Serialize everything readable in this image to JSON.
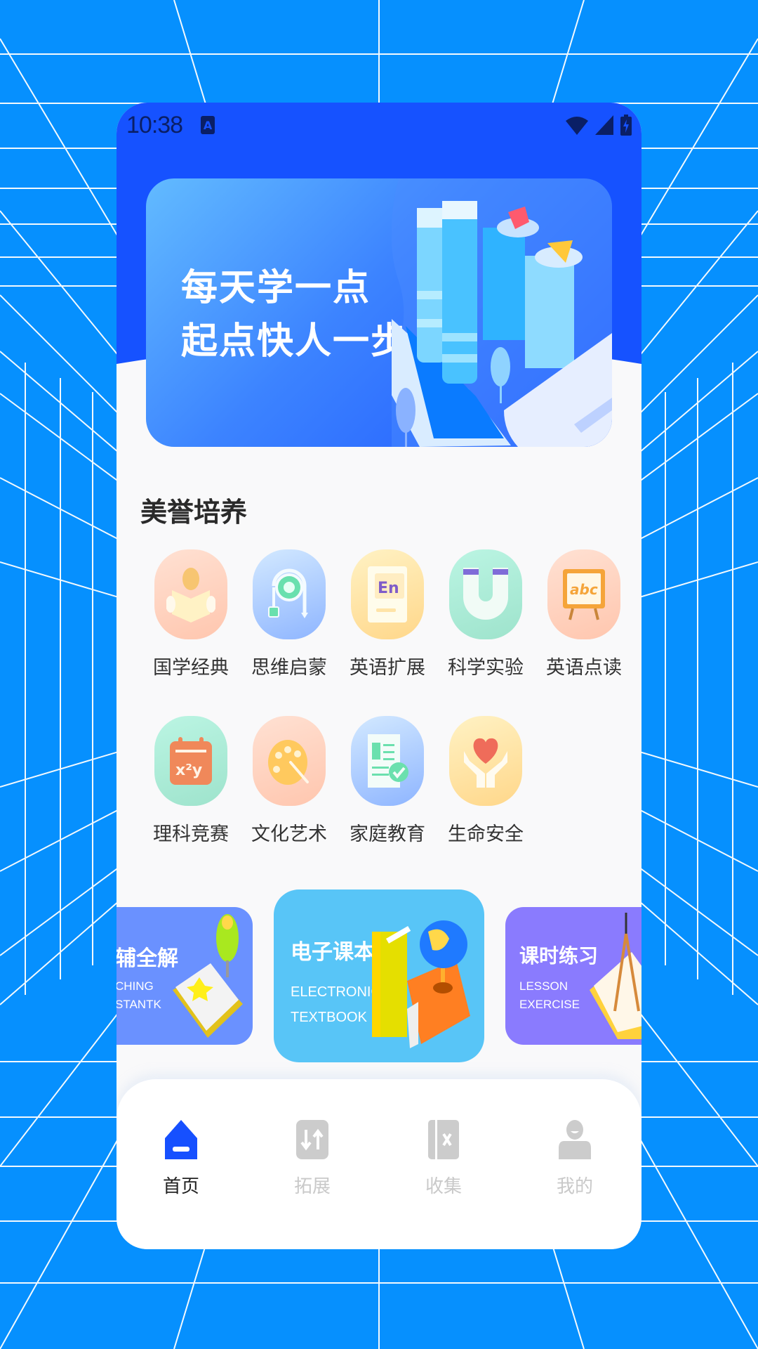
{
  "status_bar": {
    "time": "10:38",
    "input_indicator": "A"
  },
  "banner": {
    "line1": "每天学一点",
    "line2": "起点快人一步"
  },
  "section": {
    "title": "美誉培养"
  },
  "categories": [
    {
      "label": "国学经典",
      "icon": "reading-person-icon"
    },
    {
      "label": "思维启蒙",
      "icon": "thinking-cable-icon"
    },
    {
      "label": "英语扩展",
      "icon": "english-book-icon"
    },
    {
      "label": "科学实验",
      "icon": "magnet-icon"
    },
    {
      "label": "英语点读",
      "icon": "abc-board-icon"
    },
    {
      "label": "理科竞赛",
      "icon": "math-calendar-icon"
    },
    {
      "label": "文化艺术",
      "icon": "palette-icon"
    },
    {
      "label": "家庭教育",
      "icon": "checklist-document-icon"
    },
    {
      "label": "生命安全",
      "icon": "heart-hands-icon"
    }
  ],
  "carousel": {
    "left": {
      "title": "辅全解",
      "sub1": "CHING",
      "sub2": "STANTK"
    },
    "center": {
      "title": "电子课本",
      "sub1": "ELECTRONIC",
      "sub2": "TEXTBOOK"
    },
    "right": {
      "title": "课时练习",
      "sub1": "LESSON",
      "sub2": "EXERCISE"
    }
  },
  "tabbar": {
    "active_color": "#1650FF",
    "inactive_color": "#CCCCCC",
    "tabs": [
      {
        "label": "首页",
        "icon": "home-icon",
        "active": true
      },
      {
        "label": "拓展",
        "icon": "expand-arrows-icon",
        "active": false
      },
      {
        "label": "收集",
        "icon": "collection-book-icon",
        "active": false
      },
      {
        "label": "我的",
        "icon": "profile-icon",
        "active": false
      }
    ]
  },
  "colors": {
    "background": "#0690FE",
    "header": "#1652FF",
    "page": "#F9F9FA"
  }
}
